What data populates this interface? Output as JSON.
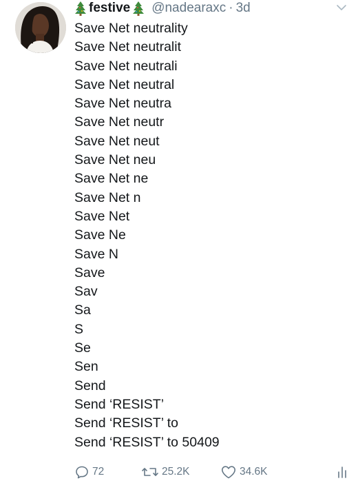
{
  "author": {
    "display_name": "festive",
    "name_emoji_left": "🎄",
    "name_emoji_right": "🎄",
    "handle": "@nadearaxc",
    "separator": "·",
    "time": "3d"
  },
  "tweet": {
    "lines": [
      "Save Net neutrality",
      "Save Net neutralit",
      "Save Net neutrali",
      "Save Net neutral",
      "Save Net neutra",
      "Save Net neutr",
      "Save Net neut",
      "Save Net neu",
      "Save Net ne",
      "Save Net n",
      "Save Net",
      "Save Ne",
      "Save N",
      "Save",
      "Sav",
      "Sa",
      "S",
      "Se",
      "Sen",
      "Send",
      "Send ‘RESIST’",
      "Send ‘RESIST’ to",
      "Send ‘RESIST’ to 50409"
    ]
  },
  "actions": {
    "reply_count": "72",
    "retweet_count": "25.2K",
    "like_count": "34.6K"
  },
  "icons": {
    "avatar": "profile-photo",
    "reply": "reply-icon",
    "retweet": "retweet-icon",
    "like": "heart-icon",
    "analytics": "analytics-icon",
    "menu": "chevron-down-icon",
    "tree": "christmas-tree-icon"
  },
  "colors": {
    "text": "#14171a",
    "secondary": "#657786",
    "tree_green": "#3f8b3c",
    "trunk": "#8b5a2b"
  }
}
